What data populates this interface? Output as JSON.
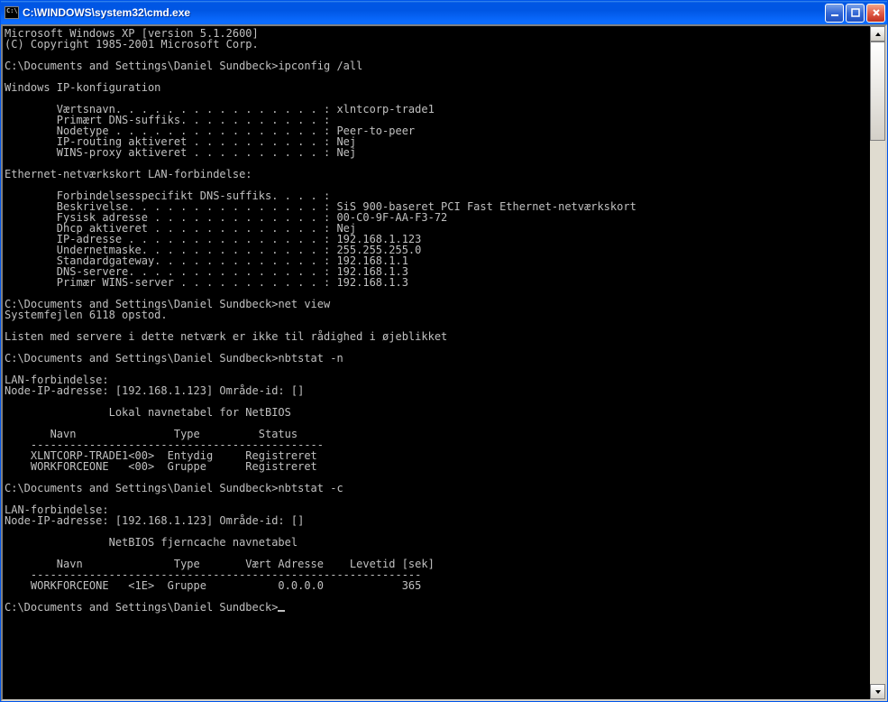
{
  "window": {
    "title": "C:\\WINDOWS\\system32\\cmd.exe"
  },
  "terminal": {
    "header1": "Microsoft Windows XP [version 5.1.2600]",
    "header2": "(C) Copyright 1985-2001 Microsoft Corp.",
    "prompt": "C:\\Documents and Settings\\Daniel Sundbeck>",
    "cmd1": "ipconfig /all",
    "sect_winip": "Windows IP-konfiguration",
    "l_host": "        Værtsnavn. . . . . . . . . . . . . . . . : xlntcorp-trade1",
    "l_dns": "        Primært DNS-suffiks. . . . . . . . . . . :",
    "l_node": "        Nodetype . . . . . . . . . . . . . . . . : Peer-to-peer",
    "l_iprt": "        IP-routing aktiveret . . . . . . . . . . : Nej",
    "l_wins": "        WINS-proxy aktiveret . . . . . . . . . . : Nej",
    "sect_eth": "Ethernet-netværkskort LAN-forbindelse:",
    "l_csuf": "        Forbindelsesspecifikt DNS-suffiks. . . . :",
    "l_desc": "        Beskrivelse. . . . . . . . . . . . . . . : SiS 900-baseret PCI Fast Ethernet-netværkskort",
    "l_phys": "        Fysisk adresse . . . . . . . . . . . . . : 00-C0-9F-AA-F3-72",
    "l_dhcp": "        Dhcp aktiveret . . . . . . . . . . . . . : Nej",
    "l_ip": "        IP-adresse . . . . . . . . . . . . . . . : 192.168.1.123",
    "l_mask": "        Undernetmaske. . . . . . . . . . . . . . : 255.255.255.0",
    "l_gw": "        Standardgateway. . . . . . . . . . . . . : 192.168.1.1",
    "l_dnss": "        DNS-servere. . . . . . . . . . . . . . . : 192.168.1.3",
    "l_pwins": "        Primær WINS-server . . . . . . . . . . . : 192.168.1.3",
    "cmd2": "net view",
    "nv_err": "Systemfejlen 6118 opstod.",
    "nv_msg": "Listen med servere i dette netværk er ikke til rådighed i øjeblikket",
    "cmd3": "nbtstat -n",
    "nb_lan": "LAN-forbindelse:",
    "nb_node": "Node-IP-adresse: [192.168.1.123] Område-id: []",
    "nb_title": "                Lokal navnetabel for NetBIOS",
    "nb_hdr": "       Navn               Type         Status",
    "nb_sep": "    ---------------------------------------------",
    "nb_r1": "    XLNTCORP-TRADE1<00>  Entydig     Registreret",
    "nb_r2": "    WORKFORCEONE   <00>  Gruppe      Registreret",
    "cmd4": "nbtstat -c",
    "nc_title": "                NetBIOS fjerncache navnetabel",
    "nc_hdr": "        Navn              Type       Vært Adresse    Levetid [sek]",
    "nc_sep": "    ------------------------------------------------------------",
    "nc_r1": "    WORKFORCEONE   <1E>  Gruppe           0.0.0.0            365"
  }
}
